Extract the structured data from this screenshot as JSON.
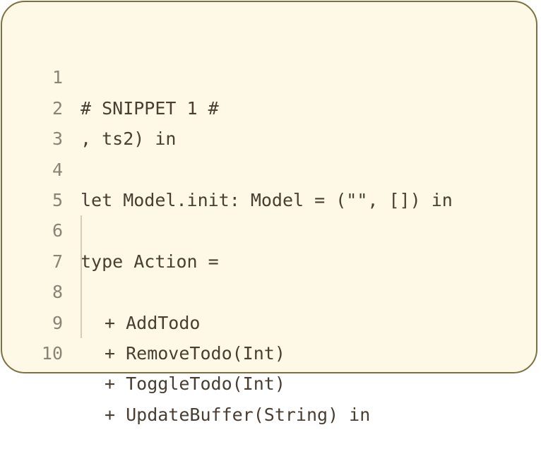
{
  "snippet": {
    "lines": [
      {
        "number": "1",
        "text": "# SNIPPET 1 #"
      },
      {
        "number": "2",
        "text": ", ts2) in"
      },
      {
        "number": "3",
        "text": ""
      },
      {
        "number": "4",
        "text": "let Model.init: Model = (\"\", []) in"
      },
      {
        "number": "5",
        "text": ""
      },
      {
        "number": "6",
        "text": "type Action ="
      },
      {
        "number": "7",
        "text": "+ AddTodo"
      },
      {
        "number": "8",
        "text": "+ RemoveTodo(Int)"
      },
      {
        "number": "9",
        "text": "+ ToggleTodo(Int)"
      },
      {
        "number": "10",
        "text": "+ UpdateBuffer(String) in"
      }
    ]
  }
}
